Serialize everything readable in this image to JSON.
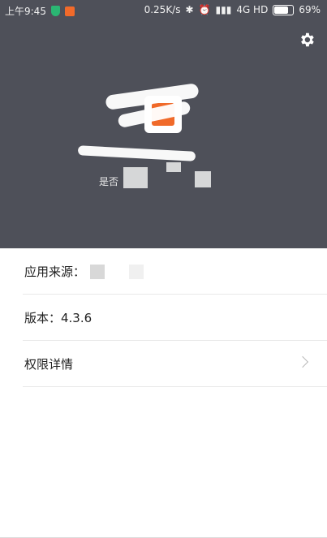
{
  "status_bar": {
    "time": "上午9:45",
    "network_speed": "0.25K/s",
    "network_type": "4G HD",
    "battery": "69%"
  },
  "header": {
    "app_name": "",
    "subtitle": "是否",
    "settings_icon": "gear-icon"
  },
  "details": {
    "source_label": "应用来源：",
    "version_label": "版本：4.3.6",
    "permissions_label": "权限详情"
  }
}
